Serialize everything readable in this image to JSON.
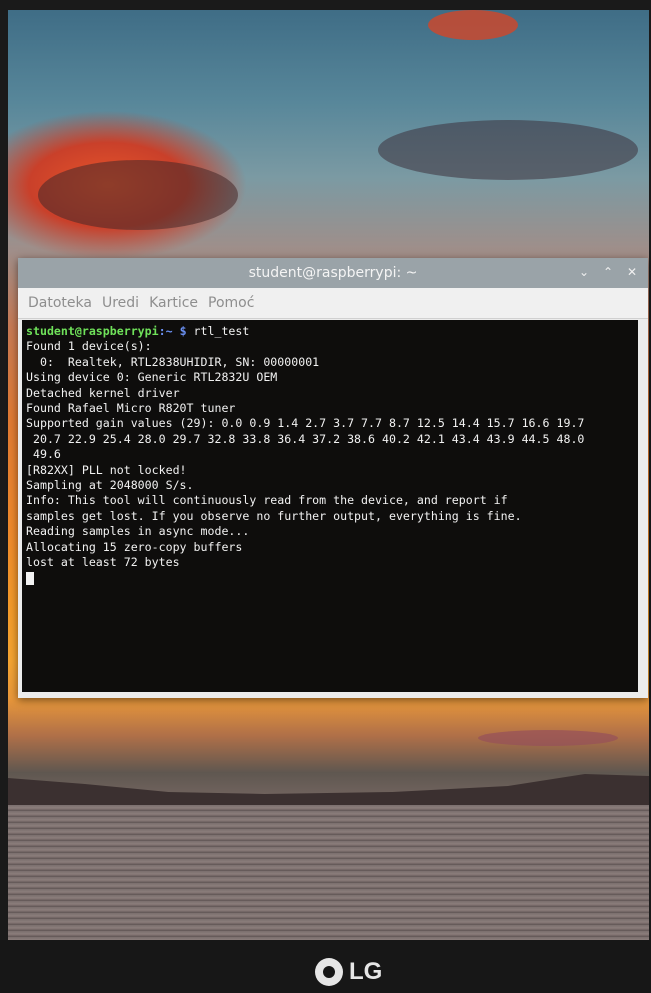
{
  "window": {
    "title": "student@raspberrypi: ~",
    "buttons": [
      "⌄",
      "⌃",
      "✕"
    ]
  },
  "menu": [
    "Datoteka",
    "Uredi",
    "Kartice",
    "Pomoć"
  ],
  "terminal": {
    "prompt_user": "student@raspberrypi",
    "prompt_path": ":~ $ ",
    "command": "rtl_test",
    "lines": [
      "Found 1 device(s):",
      "  0:  Realtek, RTL2838UHIDIR, SN: 00000001",
      "",
      "Using device 0: Generic RTL2832U OEM",
      "Detached kernel driver",
      "Found Rafael Micro R820T tuner",
      "Supported gain values (29): 0.0 0.9 1.4 2.7 3.7 7.7 8.7 12.5 14.4 15.7 16.6 19.7",
      " 20.7 22.9 25.4 28.0 29.7 32.8 33.8 36.4 37.2 38.6 40.2 42.1 43.4 43.9 44.5 48.0",
      " 49.6",
      "[R82XX] PLL not locked!",
      "Sampling at 2048000 S/s.",
      "",
      "Info: This tool will continuously read from the device, and report if",
      "samples get lost. If you observe no further output, everything is fine.",
      "",
      "Reading samples in async mode...",
      "Allocating 15 zero-copy buffers",
      "lost at least 72 bytes"
    ]
  },
  "monitor": {
    "brand": "LG"
  }
}
